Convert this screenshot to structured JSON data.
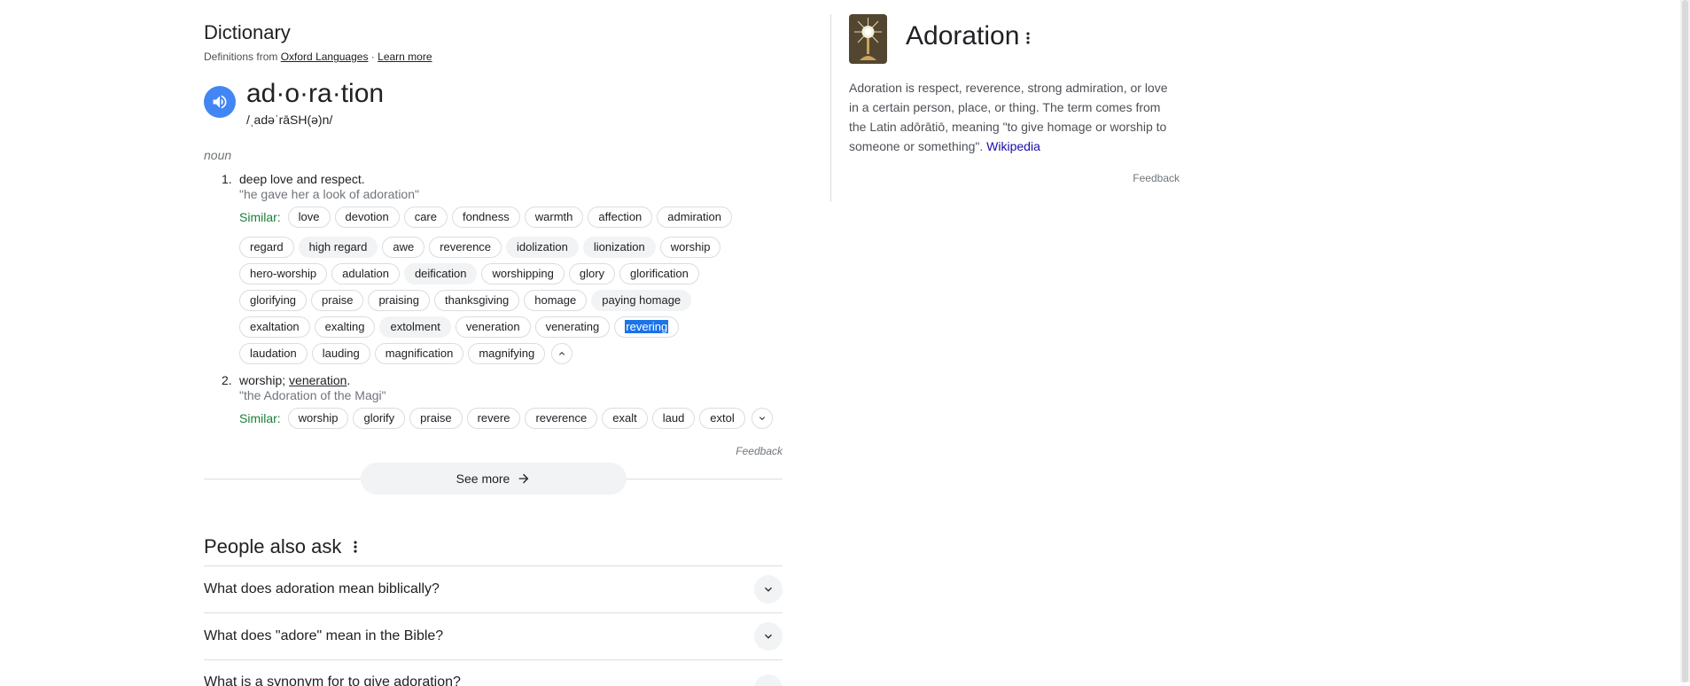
{
  "dictionary": {
    "title": "Dictionary",
    "source_prefix": "Definitions from",
    "source_link": "Oxford Languages",
    "source_sep": " · ",
    "learn_more": "Learn more",
    "headword": "ad·o·ra·tion",
    "phonetic": "/ˌadəˈrāSH(ə)n/",
    "pos": "noun",
    "senses": [
      {
        "num": "1.",
        "definition": "deep love and respect.",
        "example": "\"he gave her a look of adoration\"",
        "similar_label": "Similar:",
        "rows": [
          [
            "love",
            "devotion",
            "care",
            "fondness",
            "warmth",
            "affection",
            "admiration"
          ],
          [
            "regard",
            "high regard",
            "awe",
            "reverence",
            "idolization",
            "lionization",
            "worship"
          ],
          [
            "hero-worship",
            "adulation",
            "deification",
            "worshipping",
            "glory",
            "glorification"
          ],
          [
            "glorifying",
            "praise",
            "praising",
            "thanksgiving",
            "homage",
            "paying homage"
          ],
          [
            "exaltation",
            "exalting",
            "extolment",
            "veneration",
            "venerating",
            "revering"
          ],
          [
            "laudation",
            "lauding",
            "magnification",
            "magnifying"
          ]
        ]
      },
      {
        "num": "2.",
        "definition_prefix": "worship; ",
        "definition_link": "veneration",
        "definition_suffix": ".",
        "example": "\"the Adoration of the Magi\"",
        "similar_label": "Similar:",
        "rows": [
          [
            "worship",
            "glorify",
            "praise",
            "revere",
            "reverence",
            "exalt",
            "laud",
            "extol"
          ]
        ]
      }
    ],
    "feedback": "Feedback",
    "see_more": "See more"
  },
  "people_also_ask": {
    "title": "People also ask",
    "questions": [
      "What does adoration mean biblically?",
      "What does \"adore\" mean in the Bible?",
      "What is a synonym for to give adoration?"
    ]
  },
  "knowledge_panel": {
    "title": "Adoration",
    "description": "Adoration is respect, reverence, strong admiration, or love in a certain person, place, or thing. The term comes from the Latin adōrātiō, meaning \"to give homage or worship to someone or something\".",
    "wiki_link": "Wikipedia",
    "feedback": "Feedback"
  },
  "colors": {
    "accent_blue": "#4285f4",
    "similar_green": "#188038",
    "selection_blue": "#1a73e8",
    "link_blue": "#1a0dab"
  }
}
